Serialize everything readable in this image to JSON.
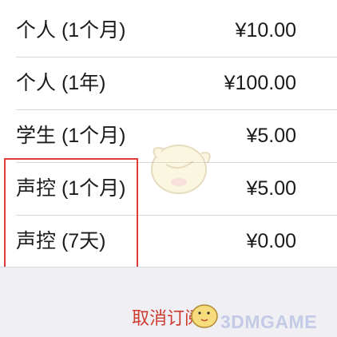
{
  "plans": [
    {
      "name": "个人 (1个月)",
      "price": "¥10.00"
    },
    {
      "name": "个人 (1年)",
      "price": "¥100.00"
    },
    {
      "name": "学生 (1个月)",
      "price": "¥5.00"
    },
    {
      "name": "声控 (1个月)",
      "price": "¥5.00"
    },
    {
      "name": "声控 (7天)",
      "price": "¥0.00"
    }
  ],
  "footer": {
    "cancel_label": "取消订阅"
  },
  "watermark": {
    "brand": "3DMGAME"
  },
  "colors": {
    "highlight_border": "#e03a3a",
    "cancel_text": "#cf3a2f",
    "background": "#efeff4"
  }
}
